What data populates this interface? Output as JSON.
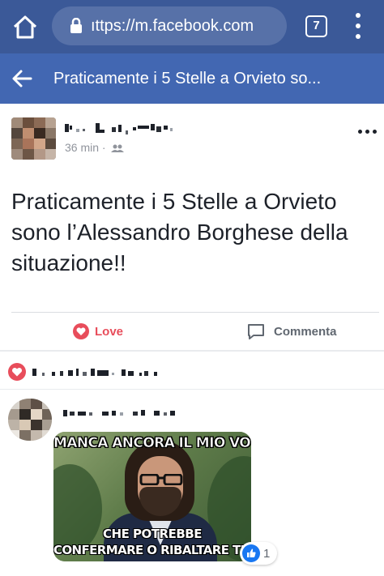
{
  "browser": {
    "url": "ıttps://m.facebook.com",
    "tab_count": "7"
  },
  "header": {
    "title": "Praticamente i 5 Stelle a Orvieto so..."
  },
  "post": {
    "time": "36 min ·",
    "text": "Praticamente i 5 Stelle a Orvieto sono l’Alessandro Borghese della situazione!!",
    "audience_icon": "friends-icon"
  },
  "actions": {
    "love_label": "Love",
    "comment_label": "Commenta"
  },
  "colors": {
    "fb_blue": "#4267b2",
    "browser_blue": "#3b5998",
    "love_red": "#e84d5b"
  },
  "comment": {
    "meme_top": "MANCA ANCORA IL MIO VOTO",
    "meme_bottom_1": "CHE POTREBBE",
    "meme_bottom_2": "CONFERMARE O RIBALTARE TUTTI",
    "like_count": "1"
  }
}
